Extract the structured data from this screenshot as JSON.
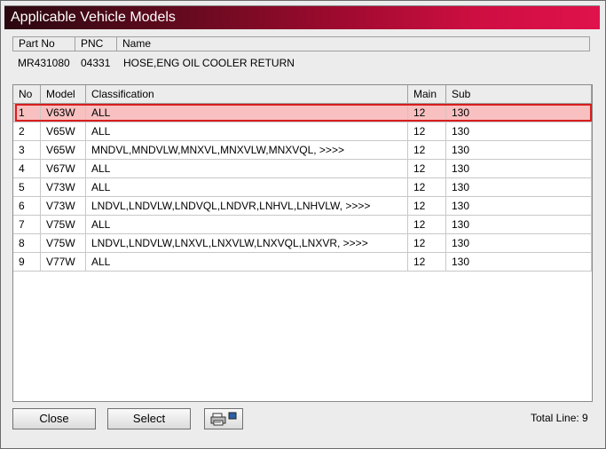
{
  "window": {
    "title": "Applicable Vehicle Models"
  },
  "part": {
    "headers": [
      "Part No",
      "PNC",
      "Name"
    ],
    "part_no": "MR431080",
    "pnc": "04331",
    "name": "HOSE,ENG OIL COOLER RETURN"
  },
  "grid": {
    "headers": [
      "No",
      "Model",
      "Classification",
      "Main",
      "Sub"
    ],
    "rows": [
      {
        "no": "1",
        "model": "V63W",
        "classification": "ALL",
        "main": "12",
        "sub": "130",
        "selected": true
      },
      {
        "no": "2",
        "model": "V65W",
        "classification": "ALL",
        "main": "12",
        "sub": "130"
      },
      {
        "no": "3",
        "model": "V65W",
        "classification": "MNDVL,MNDVLW,MNXVL,MNXVLW,MNXVQL,  >>>>",
        "main": "12",
        "sub": "130"
      },
      {
        "no": "4",
        "model": "V67W",
        "classification": "ALL",
        "main": "12",
        "sub": "130"
      },
      {
        "no": "5",
        "model": "V73W",
        "classification": "ALL",
        "main": "12",
        "sub": "130"
      },
      {
        "no": "6",
        "model": "V73W",
        "classification": "LNDVL,LNDVLW,LNDVQL,LNDVR,LNHVL,LNHVLW,  >>>>",
        "main": "12",
        "sub": "130"
      },
      {
        "no": "7",
        "model": "V75W",
        "classification": "ALL",
        "main": "12",
        "sub": "130"
      },
      {
        "no": "8",
        "model": "V75W",
        "classification": "LNDVL,LNDVLW,LNXVL,LNXVLW,LNXVQL,LNXVR,  >>>>",
        "main": "12",
        "sub": "130"
      },
      {
        "no": "9",
        "model": "V77W",
        "classification": "ALL",
        "main": "12",
        "sub": "130"
      }
    ]
  },
  "footer": {
    "close_label": "Close",
    "select_label": "Select",
    "print_icon": "printer-icon",
    "total_line": "Total Line: 9"
  }
}
